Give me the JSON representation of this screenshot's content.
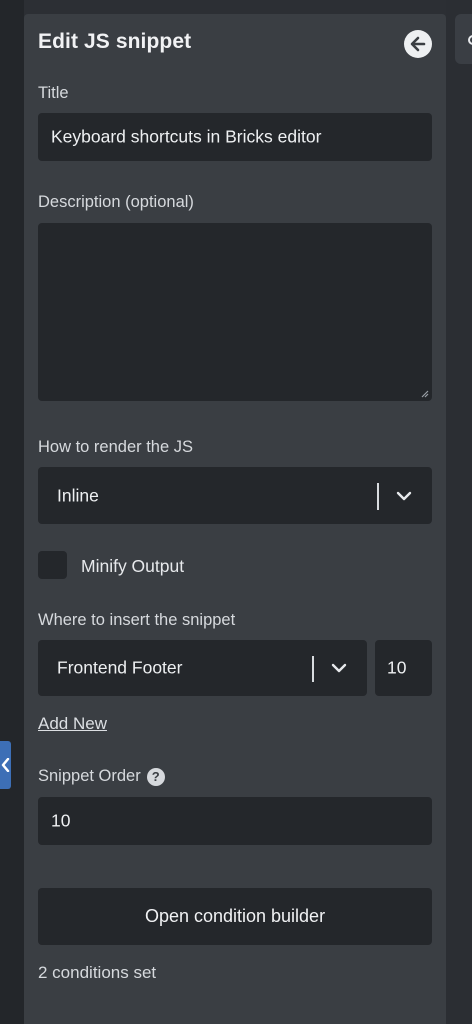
{
  "panel": {
    "title": "Edit JS snippet",
    "back_icon": "arrow-left-circle-icon"
  },
  "form": {
    "title_label": "Title",
    "title_value": "Keyboard shortcuts in Bricks editor",
    "description_label": "Description (optional)",
    "description_value": "",
    "render_label": "How to render the JS",
    "render_value": "Inline",
    "minify_label": "Minify Output",
    "minify_checked": false,
    "insert_label": "Where to insert the snippet",
    "insert_value": "Frontend Footer",
    "insert_priority": "10",
    "add_new_link": "Add New",
    "order_label": "Snippet Order",
    "order_value": "10",
    "condition_button": "Open condition builder",
    "conditions_status": "2 conditions set"
  },
  "colors": {
    "background": "#2c2f34",
    "panel": "#3a3e43",
    "field": "#24272b",
    "accent_tab": "#3d6fb6",
    "text": "#e7e9ec"
  }
}
